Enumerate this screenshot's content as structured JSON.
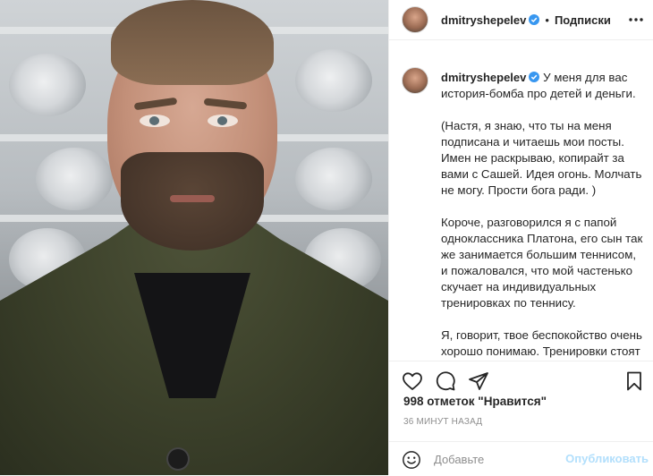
{
  "post": {
    "username": "dmitryshepelev",
    "follow_label": "Подписки",
    "dot": "•",
    "caption_username": "dmitryshepelev",
    "caption_paragraphs": [
      "У меня для вас история-бомба про детей и деньги.",
      "(Настя, я знаю, что ты на меня подписана и читаешь мои посты. Имен не раскрываю, копирайт за вами с Сашей. Идея огонь. Молчать не могу. Прости бога ради. )",
      "Короче, разговорился я с папой одноклассника Платона, его сын так же занимается большим теннисом, и пожаловался, что мой частенько скучает на индивидуальных тренировках по теннису.",
      "Я, говорит, твое беспокойство очень хорошо понимаю. Тренировки стоят не хилых денег и очень обидно, что ребенок на них мух считает. Я вот"
    ],
    "likes": "998 отметок \"Нравится\"",
    "time": "36 минут назад"
  },
  "comment": {
    "placeholder": "Добавьте комментарий...",
    "placeholder_visible": "Добавьте",
    "post_label": "Опубликовать"
  },
  "icons": {
    "verified": "verified-badge-icon",
    "more": "more-options-icon",
    "like": "heart-icon",
    "comment": "comment-icon",
    "share": "share-icon",
    "save": "bookmark-icon",
    "emoji": "emoji-icon"
  },
  "colors": {
    "verified": "#3897f0",
    "post_button_disabled": "#b2dffc",
    "muted": "#8e8e8e"
  }
}
